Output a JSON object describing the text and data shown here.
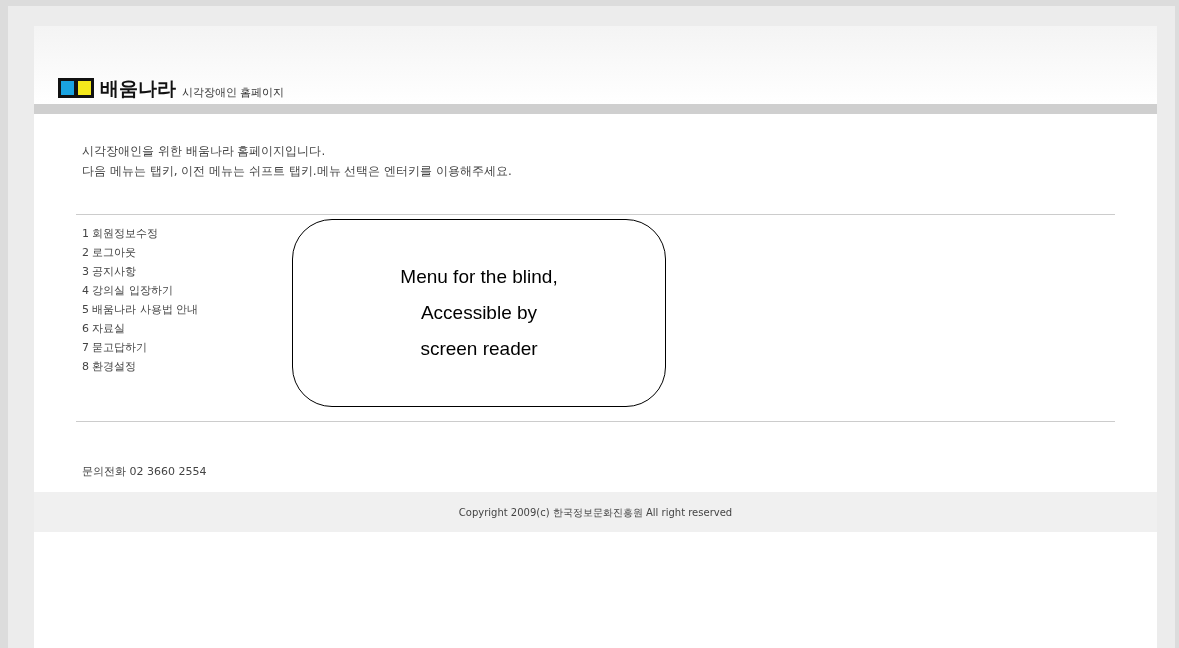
{
  "header": {
    "brand": "배움나라",
    "subtitle": "시각장애인 홈페이지"
  },
  "intro": [
    "시각장애인을 위한 배움나라 홈페이지입니다.",
    "다음 메뉴는 탭키, 이전 메뉴는 쉬프트 탭키.메뉴 선택은 엔터키를 이용해주세요."
  ],
  "menu": [
    "1 회원정보수정",
    "2 로그아웃",
    "3 공지사항",
    "4 강의실 입장하기",
    "5 배움나라 사용법 안내",
    "6 자료실",
    "7 묻고답하기",
    "8 환경설정"
  ],
  "callout": [
    "Menu for the blind,",
    "Accessible by",
    "screen reader"
  ],
  "contact": "문의전화 02 3660 2554",
  "footer": "Copyright 2009(c) 한국정보문화진흥원 All right reserved"
}
